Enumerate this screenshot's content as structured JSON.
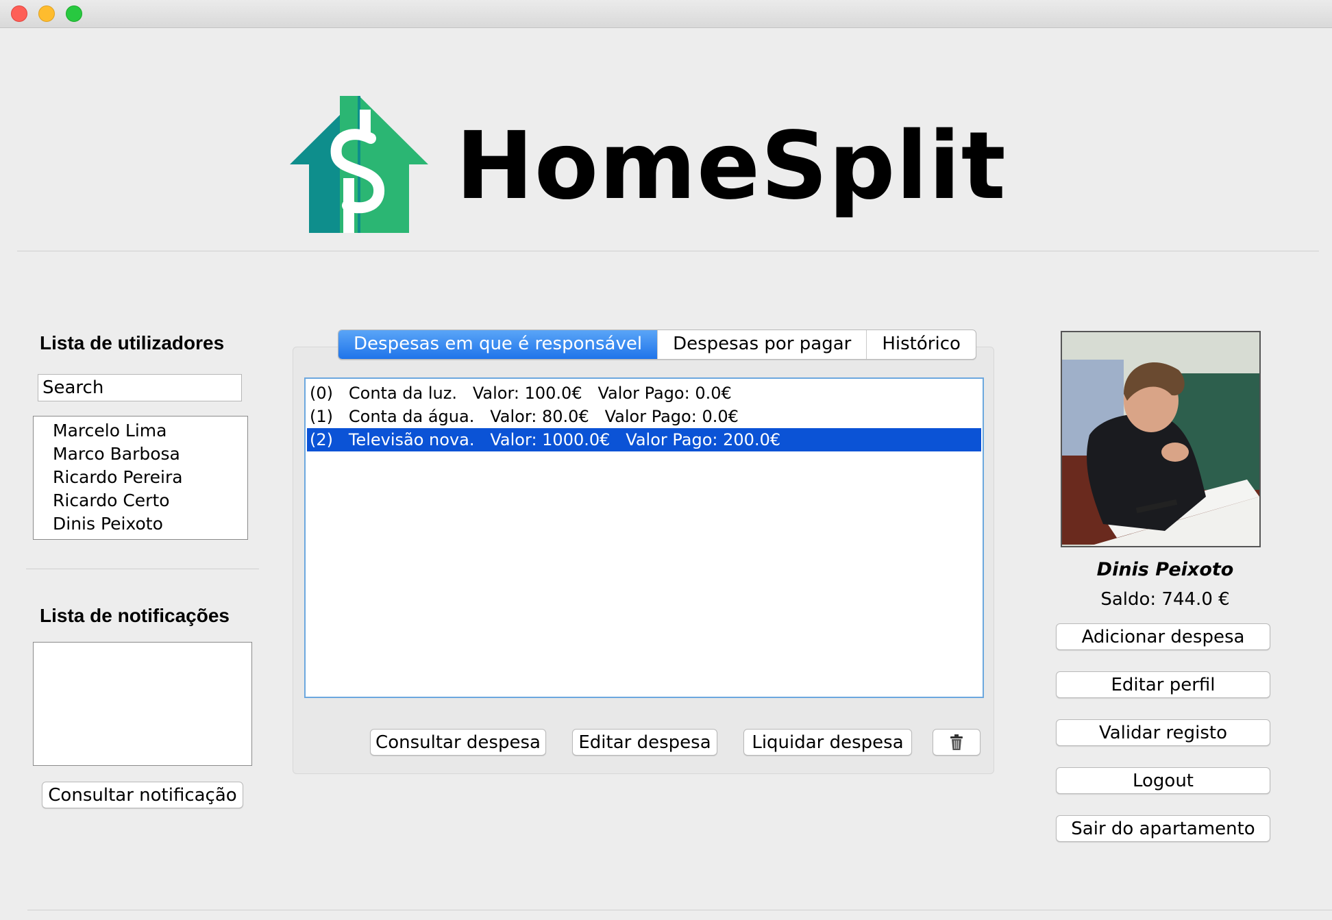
{
  "window": {
    "controls": [
      "close",
      "minimize",
      "maximize"
    ]
  },
  "brand": {
    "name": "HomeSplit",
    "icon_colors": [
      "#0e8e8c",
      "#2bb673"
    ]
  },
  "users_panel": {
    "title": "Lista de utilizadores",
    "search_value": "Search",
    "users": [
      "Marcelo Lima",
      "Marco Barbosa",
      "Ricardo Pereira",
      "Ricardo Certo",
      "Dinis Peixoto"
    ]
  },
  "notifications_panel": {
    "title": "Lista de notificações",
    "notifications": [],
    "consult_button": "Consultar notificação"
  },
  "tabs": [
    {
      "label": "Despesas em que é responsável",
      "active": true
    },
    {
      "label": "Despesas por pagar",
      "active": false
    },
    {
      "label": "Histórico",
      "active": false
    }
  ],
  "expenses": [
    {
      "text": "(0)   Conta da luz.   Valor: 100.0€   Valor Pago: 0.0€",
      "selected": false
    },
    {
      "text": "(1)   Conta da água.   Valor: 80.0€   Valor Pago: 0.0€",
      "selected": false
    },
    {
      "text": "(2)   Televisão nova.   Valor: 1000.0€   Valor Pago: 200.0€",
      "selected": true
    }
  ],
  "expense_actions": {
    "consult": "Consultar despesa",
    "edit": "Editar despesa",
    "settle": "Liquidar despesa",
    "delete_icon": "trash-icon"
  },
  "profile": {
    "name": "Dinis Peixoto",
    "balance_label": "Saldo:",
    "balance_value": "744.0 €",
    "buttons": {
      "add_expense": "Adicionar despesa",
      "edit_profile": "Editar perfil",
      "validate": "Validar registo",
      "logout": "Logout",
      "leave": "Sair do apartamento"
    }
  },
  "colors": {
    "accent_tab": "#1f74ea",
    "selection": "#0b53d6",
    "list_border": "#6ba7de"
  }
}
